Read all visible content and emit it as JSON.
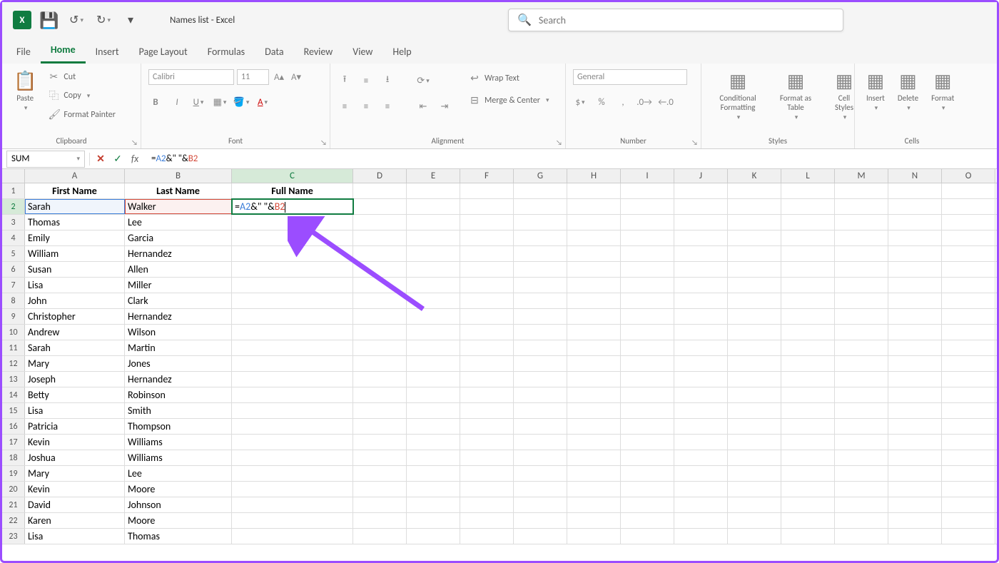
{
  "titlebar": {
    "title": "Names list  -  Excel",
    "search_placeholder": "Search"
  },
  "tabs": [
    "File",
    "Home",
    "Insert",
    "Page Layout",
    "Formulas",
    "Data",
    "Review",
    "View",
    "Help"
  ],
  "active_tab": "Home",
  "ribbon": {
    "clipboard": {
      "label": "Clipboard",
      "paste": "Paste",
      "cut": "Cut",
      "copy": "Copy",
      "painter": "Format Painter"
    },
    "font": {
      "label": "Font",
      "name": "Calibri",
      "size": "11"
    },
    "alignment": {
      "label": "Alignment",
      "wrap": "Wrap Text",
      "merge": "Merge & Center"
    },
    "number": {
      "label": "Number",
      "format": "General"
    },
    "styles": {
      "label": "Styles",
      "cond": "Conditional Formatting",
      "table": "Format as Table",
      "cell": "Cell Styles"
    },
    "cells": {
      "label": "Cells",
      "insert": "Insert",
      "delete": "Delete",
      "format": "Format"
    }
  },
  "formula_bar": {
    "namebox": "SUM",
    "formula_parts": [
      {
        "text": "=",
        "cls": "f-black"
      },
      {
        "text": "A2",
        "cls": "f-blue"
      },
      {
        "text": "&\" \"&",
        "cls": "f-black"
      },
      {
        "text": "B2",
        "cls": "f-red"
      }
    ]
  },
  "grid": {
    "columns": [
      "A",
      "B",
      "C",
      "D",
      "E",
      "F",
      "G",
      "H",
      "I",
      "J",
      "K",
      "L",
      "M",
      "N",
      "O"
    ],
    "headers": [
      "First Name",
      "Last Name",
      "Full Name"
    ],
    "rows": [
      [
        "Sarah",
        "Walker"
      ],
      [
        "Thomas",
        "Lee"
      ],
      [
        "Emily",
        "Garcia"
      ],
      [
        "William",
        "Hernandez"
      ],
      [
        "Susan",
        "Allen"
      ],
      [
        "Lisa",
        "Miller"
      ],
      [
        "John",
        "Clark"
      ],
      [
        "Christopher",
        "Hernandez"
      ],
      [
        "Andrew",
        "Wilson"
      ],
      [
        "Sarah",
        "Martin"
      ],
      [
        "Mary",
        "Jones"
      ],
      [
        "Joseph",
        "Hernandez"
      ],
      [
        "Betty",
        "Robinson"
      ],
      [
        "Lisa",
        "Smith"
      ],
      [
        "Patricia",
        "Thompson"
      ],
      [
        "Kevin",
        "Williams"
      ],
      [
        "Joshua",
        "Williams"
      ],
      [
        "Mary",
        "Lee"
      ],
      [
        "Kevin",
        "Moore"
      ],
      [
        "David",
        "Johnson"
      ],
      [
        "Karen",
        "Moore"
      ],
      [
        "Lisa",
        "Thomas"
      ]
    ],
    "editing_cell_parts": [
      {
        "text": "=",
        "cls": "f-black"
      },
      {
        "text": "A2",
        "cls": "f-blue"
      },
      {
        "text": "&\" \"&",
        "cls": "f-black"
      },
      {
        "text": "B2",
        "cls": "f-red"
      }
    ]
  }
}
